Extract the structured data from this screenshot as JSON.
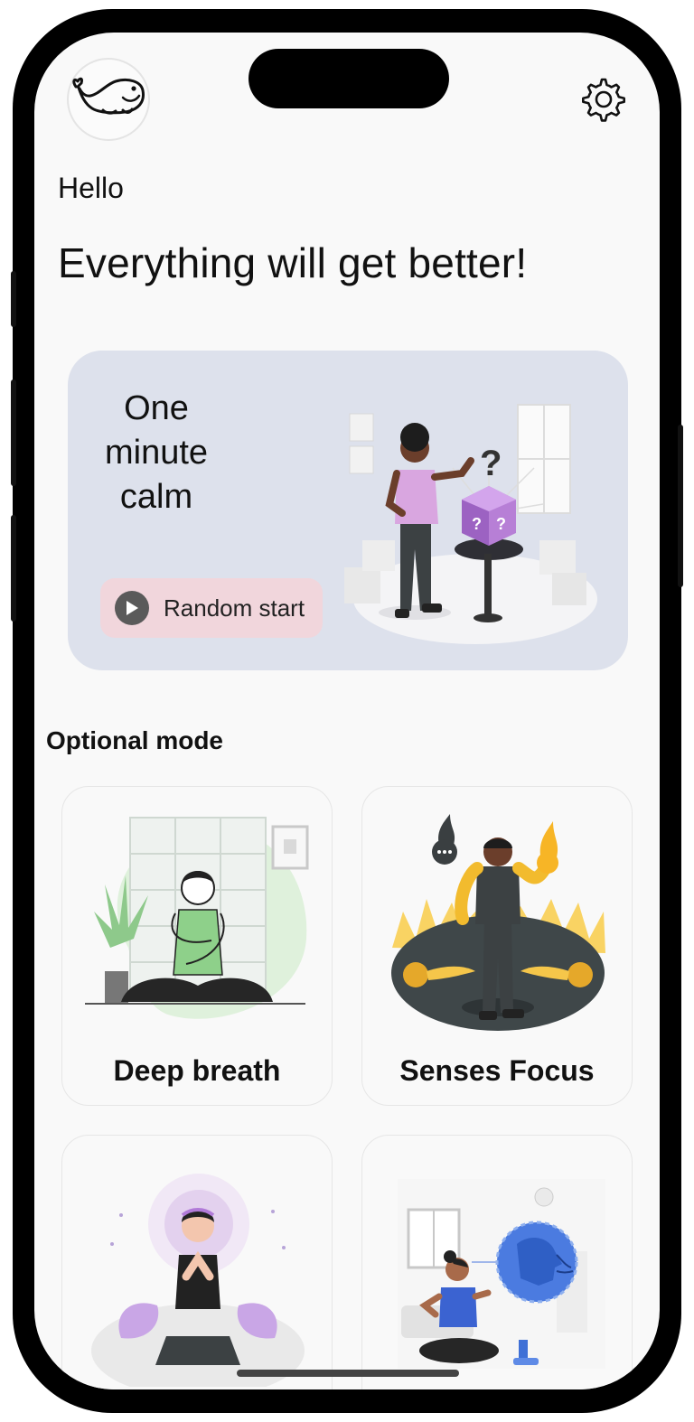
{
  "header": {
    "avatar_icon": "whale-icon",
    "settings_icon": "gear-icon"
  },
  "greeting": "Hello",
  "headline": "Everything will get better!",
  "hero": {
    "title": "One minute calm",
    "button_label": "Random start",
    "button_icon": "play-icon",
    "background": "#dde1ec",
    "button_color": "#f1d6dc"
  },
  "section_title": "Optional mode",
  "modes": [
    {
      "label": "Deep breath"
    },
    {
      "label": "Senses Focus"
    },
    {
      "label": ""
    },
    {
      "label": ""
    }
  ]
}
